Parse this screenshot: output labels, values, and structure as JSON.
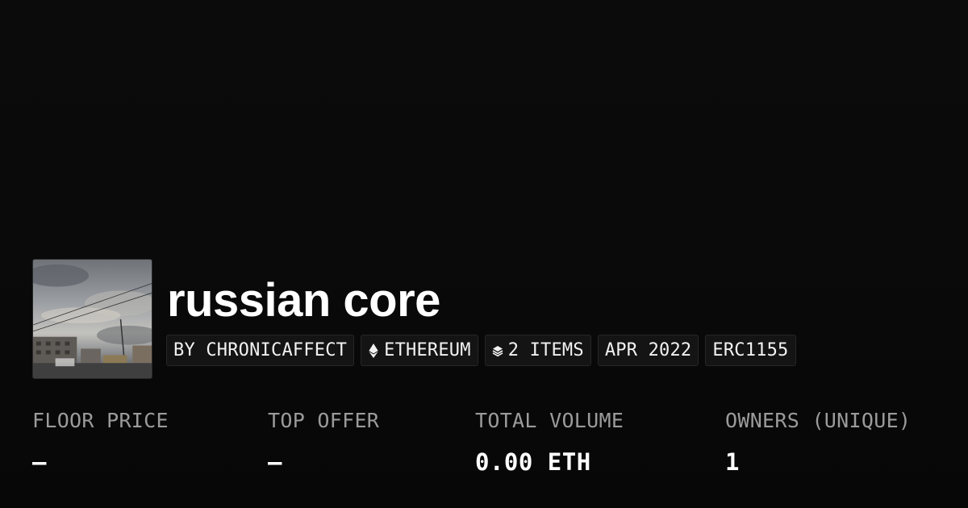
{
  "collection": {
    "name": "russian core",
    "image_alt": "cloudy sky over city street thumbnail",
    "tags": [
      {
        "label": "BY CHRONICAFFECT",
        "icon": null
      },
      {
        "label": "ETHEREUM",
        "icon": "ethereum-icon"
      },
      {
        "label": "2 ITEMS",
        "icon": "layers-icon"
      },
      {
        "label": "APR 2022",
        "icon": null
      },
      {
        "label": "ERC1155",
        "icon": null
      }
    ]
  },
  "stats": [
    {
      "label": "FLOOR PRICE",
      "value": "–"
    },
    {
      "label": "TOP OFFER",
      "value": "–"
    },
    {
      "label": "TOTAL VOLUME",
      "value": "0.00 ETH"
    },
    {
      "label": "OWNERS (UNIQUE)",
      "value": "1"
    }
  ],
  "colors": {
    "background": "#0a0a0a",
    "chip_background": "#141414",
    "chip_border": "#262626",
    "label_gray": "#9b9b9b",
    "text_white": "#ffffff"
  }
}
